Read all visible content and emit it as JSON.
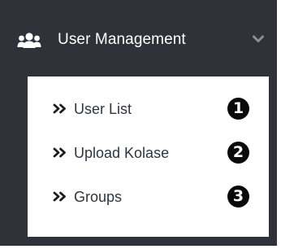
{
  "menu": {
    "icon": "users-icon",
    "title": "User Management",
    "toggle_icon": "chevron-down-icon",
    "expanded": true
  },
  "submenu": {
    "item_icon": "double-chevron-right-icon",
    "items": [
      {
        "label": "User List",
        "badge": "1"
      },
      {
        "label": "Upload Kolase",
        "badge": "2"
      },
      {
        "label": "Groups",
        "badge": "3"
      }
    ]
  },
  "colors": {
    "sidebar_background": "#2f3238",
    "submenu_background": "#ffffff",
    "menu_text": "#ffffff",
    "submenu_text": "#2e3540",
    "chevron": "#8a8f96",
    "badge_background": "#0a0a0a",
    "badge_text": "#ffffff"
  }
}
